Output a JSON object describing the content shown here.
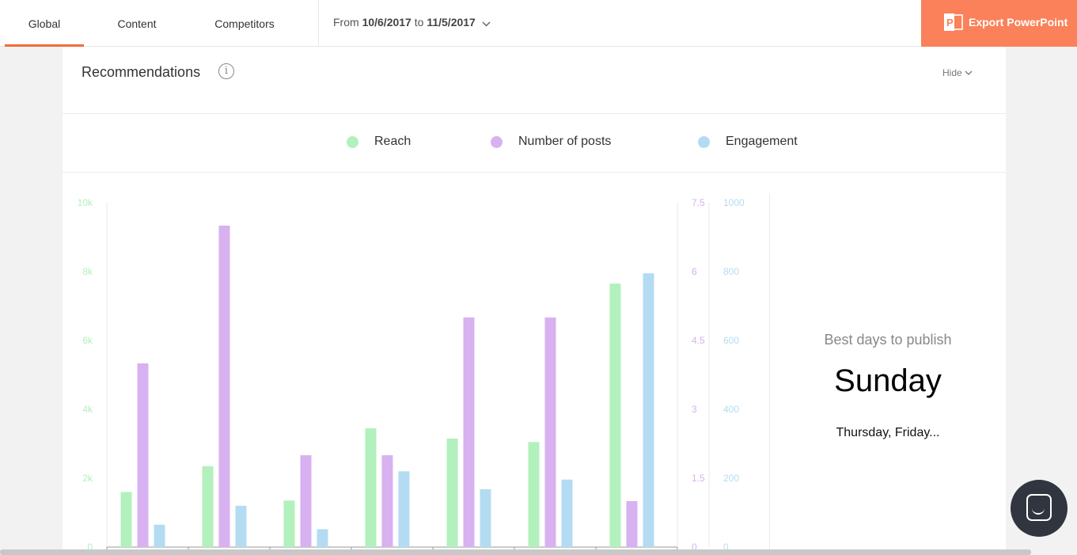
{
  "tabs": [
    {
      "label": "Global",
      "active": true
    },
    {
      "label": "Content",
      "active": false
    },
    {
      "label": "Competitors",
      "active": false
    }
  ],
  "date_range": {
    "prefix": "From",
    "start": "10/6/2017",
    "connector": "to",
    "end": "11/5/2017"
  },
  "export_button": "Export PowerPoint",
  "section": {
    "title": "Recommendations",
    "hide_label": "Hide"
  },
  "legend": [
    {
      "label": "Reach",
      "color": "#b2f0bd"
    },
    {
      "label": "Number of posts",
      "color": "#d8b1f0"
    },
    {
      "label": "Engagement",
      "color": "#b3dcf3"
    }
  ],
  "best_days": {
    "label": "Best days to publish",
    "day": "Sunday",
    "others": "Thursday, Friday..."
  },
  "colors": {
    "accent": "#f26b3a",
    "export_bg": "#fa8159",
    "reach": "#b2f0bd",
    "posts": "#d8b1f0",
    "engagement": "#b3dcf3"
  },
  "chart_data": {
    "type": "bar",
    "categories": [
      "",
      "",
      "",
      "",
      "",
      "",
      ""
    ],
    "series": [
      {
        "name": "Reach",
        "axis": "left",
        "values": [
          1600,
          2350,
          1350,
          3450,
          3150,
          3050,
          7650
        ]
      },
      {
        "name": "Number of posts",
        "axis": "right1",
        "values": [
          4,
          7,
          2,
          2,
          5,
          5,
          1
        ]
      },
      {
        "name": "Engagement",
        "axis": "right2",
        "values": [
          65,
          120,
          52,
          220,
          168,
          196,
          795
        ]
      }
    ],
    "axes": {
      "left": {
        "ticks": [
          "0",
          "2k",
          "4k",
          "6k",
          "8k",
          "10k"
        ],
        "range": [
          0,
          10000
        ]
      },
      "right1": {
        "ticks": [
          "0",
          "1.5",
          "3",
          "4.5",
          "6",
          "7.5"
        ],
        "range": [
          0,
          7.5
        ]
      },
      "right2": {
        "ticks": [
          "0",
          "200",
          "400",
          "600",
          "800",
          "1000"
        ],
        "range": [
          0,
          1000
        ]
      }
    }
  }
}
